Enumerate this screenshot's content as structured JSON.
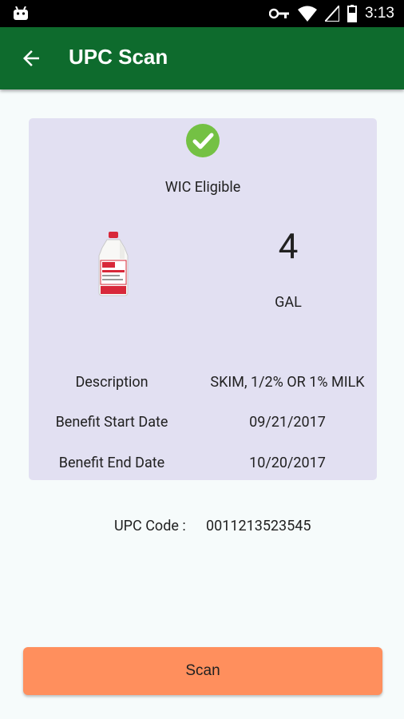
{
  "status_bar": {
    "time": "3:13"
  },
  "app_bar": {
    "title": "UPC Scan"
  },
  "card": {
    "eligibility": "WIC Eligible",
    "quantity": "4",
    "unit": "GAL",
    "details": [
      {
        "label": "Description",
        "value": "SKIM, 1/2% OR 1% MILK"
      },
      {
        "label": "Benefit Start Date",
        "value": "09/21/2017"
      },
      {
        "label": "Benefit End Date",
        "value": "10/20/2017"
      }
    ]
  },
  "upc": {
    "label": "UPC Code :",
    "value": "0011213523545"
  },
  "scan_button": {
    "label": "Scan"
  },
  "colors": {
    "app_bar": "#0e6b2d",
    "card": "#e2e0f2",
    "check": "#74c144",
    "button": "#ff8f5d"
  }
}
